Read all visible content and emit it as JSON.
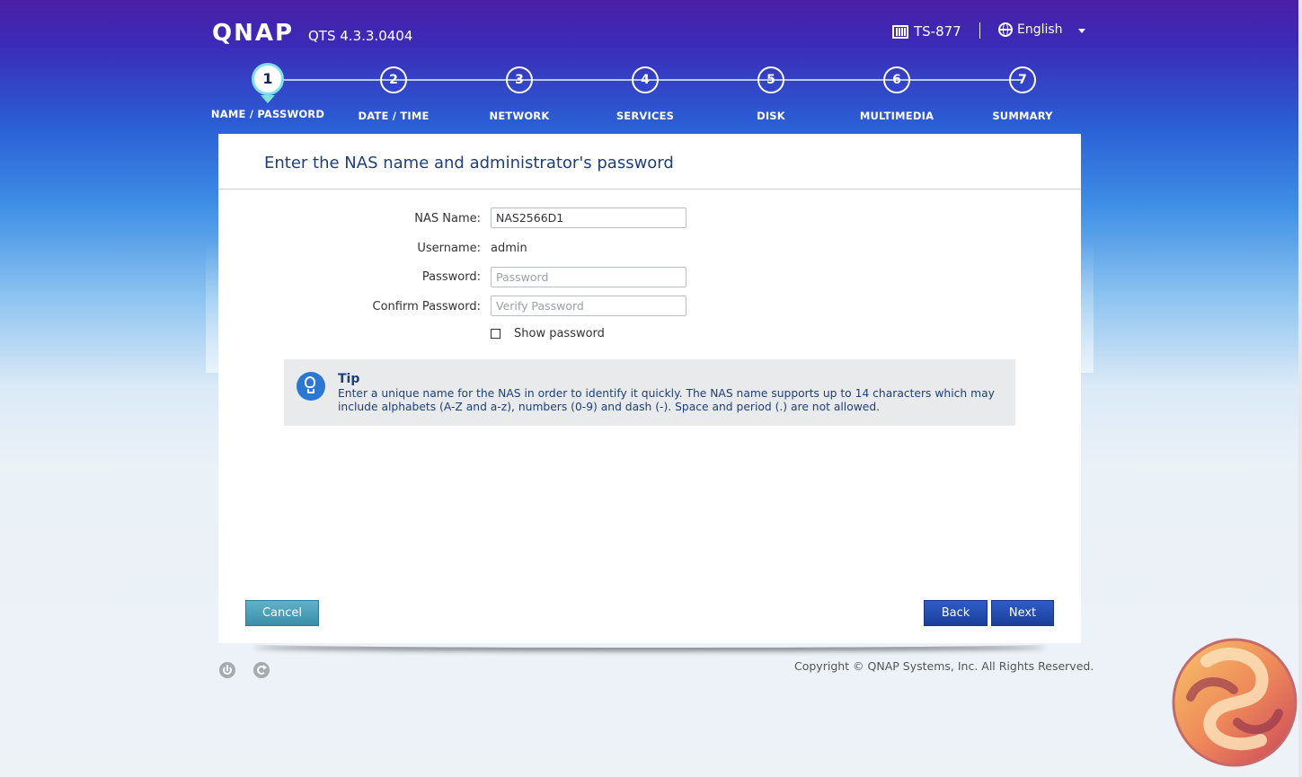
{
  "header": {
    "logo": "QNAP",
    "version": "QTS 4.3.3.0404",
    "model": "TS-877",
    "language": "English"
  },
  "steps": [
    {
      "number": "1",
      "label": "NAME / PASSWORD",
      "active": true
    },
    {
      "number": "2",
      "label": "DATE / TIME"
    },
    {
      "number": "3",
      "label": "NETWORK"
    },
    {
      "number": "4",
      "label": "SERVICES"
    },
    {
      "number": "5",
      "label": "DISK"
    },
    {
      "number": "6",
      "label": "MULTIMEDIA"
    },
    {
      "number": "7",
      "label": "SUMMARY"
    }
  ],
  "panel": {
    "title": "Enter the NAS name and administrator's password",
    "nas_name_label": "NAS Name:",
    "nas_name_value": "NAS2566D1",
    "username_label": "Username:",
    "username_value": "admin",
    "password_label": "Password:",
    "password_placeholder": "Password",
    "confirm_label": "Confirm Password:",
    "confirm_placeholder": "Verify Password",
    "show_password_label": "Show password",
    "show_password_checked": false
  },
  "tip": {
    "title": "Tip",
    "text": "Enter a unique name for the NAS in order to identify it quickly. The NAS name supports up to 14 characters which may include alphabets (A-Z and a-z), numbers (0-9) and dash (-). Space and period (.) are not allowed."
  },
  "buttons": {
    "cancel": "Cancel",
    "back": "Back",
    "next": "Next"
  },
  "footer": {
    "copyright": "Copyright © QNAP Systems, Inc. All Rights Reserved.",
    "icons": [
      "power-icon",
      "restart-icon"
    ]
  },
  "colors": {
    "title_blue": "#1f3f7a",
    "button_blue": "#1b3f9a",
    "cancel_teal": "#3b8ea8",
    "active_step_ring": "#7ee0e8"
  }
}
